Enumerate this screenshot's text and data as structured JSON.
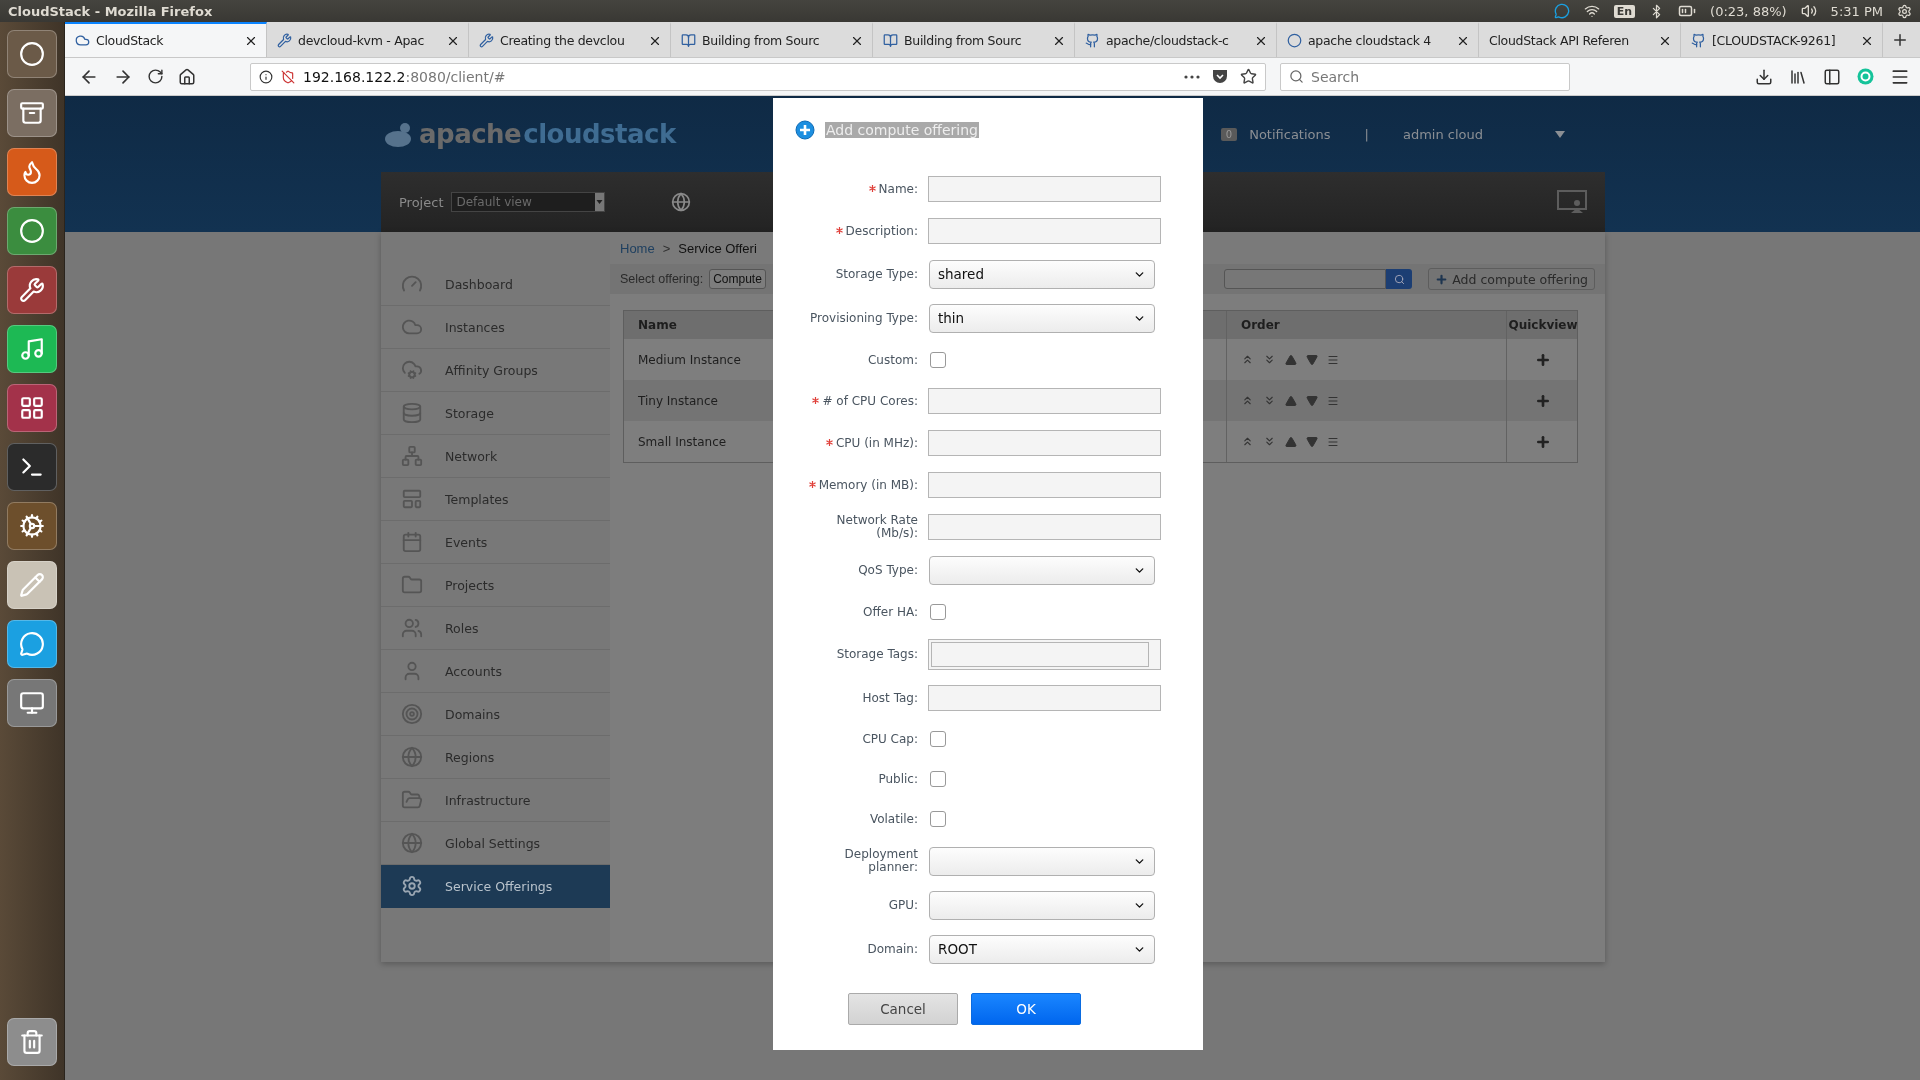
{
  "os_bar": {
    "title": "CloudStack - Mozilla Firefox",
    "keyboard": "En",
    "battery": "(0:23, 88%)",
    "clock": "5:31 PM"
  },
  "browser": {
    "tabs": [
      {
        "label": "CloudStack",
        "selected": true
      },
      {
        "label": "devcloud-kvm - Apac",
        "selected": false
      },
      {
        "label": "Creating the devclou",
        "selected": false
      },
      {
        "label": "Building from Sourc",
        "selected": false
      },
      {
        "label": "Building from Sourc",
        "selected": false
      },
      {
        "label": "apache/cloudstack-c",
        "selected": false
      },
      {
        "label": "apache cloudstack 4",
        "selected": false
      },
      {
        "label": "CloudStack API Referen",
        "selected": false
      },
      {
        "label": "[CLOUDSTACK-9261]",
        "selected": false
      }
    ],
    "url_host": "192.168.122.2",
    "url_path": ":8080/client/#",
    "search": {
      "placeholder": "Search"
    }
  },
  "app": {
    "logo": [
      "apache",
      "cloudstack"
    ],
    "notifications": {
      "count": "0",
      "label": "Notifications"
    },
    "separator": "|",
    "user": "admin cloud",
    "project": {
      "label": "Project",
      "value": "Default view"
    },
    "sidebar": [
      {
        "label": "Dashboard",
        "selected": false
      },
      {
        "label": "Instances",
        "selected": false
      },
      {
        "label": "Affinity Groups",
        "selected": false
      },
      {
        "label": "Storage",
        "selected": false
      },
      {
        "label": "Network",
        "selected": false
      },
      {
        "label": "Templates",
        "selected": false
      },
      {
        "label": "Events",
        "selected": false
      },
      {
        "label": "Projects",
        "selected": false
      },
      {
        "label": "Roles",
        "selected": false
      },
      {
        "label": "Accounts",
        "selected": false
      },
      {
        "label": "Domains",
        "selected": false
      },
      {
        "label": "Regions",
        "selected": false
      },
      {
        "label": "Infrastructure",
        "selected": false
      },
      {
        "label": "Global Settings",
        "selected": false
      },
      {
        "label": "Service Offerings",
        "selected": true
      }
    ],
    "breadcrumb": {
      "home": "Home",
      "separator": ">",
      "current": "Service Offeri"
    },
    "toolbar": {
      "label": "Select offering:",
      "value": "Compute",
      "add_button": "Add compute offering"
    },
    "table": {
      "columns": [
        "Name",
        "Order",
        "Quickview"
      ],
      "rows": [
        {
          "name": "Medium Instance"
        },
        {
          "name": "Tiny Instance"
        },
        {
          "name": "Small Instance"
        }
      ]
    }
  },
  "dialog": {
    "title": "Add compute offering",
    "fields": [
      {
        "kind": "text",
        "label": "Name:",
        "required": true
      },
      {
        "kind": "text",
        "label": "Description:",
        "required": true
      },
      {
        "kind": "select",
        "label": "Storage Type:",
        "value": "shared",
        "required": false
      },
      {
        "kind": "select",
        "label": "Provisioning Type:",
        "value": "thin",
        "required": false
      },
      {
        "kind": "checkbox",
        "label": "Custom:",
        "checked": false,
        "required": false
      },
      {
        "kind": "text",
        "label": "# of CPU Cores:",
        "required": true
      },
      {
        "kind": "text",
        "label": "CPU (in MHz):",
        "required": true
      },
      {
        "kind": "text",
        "label": "Memory (in MB):",
        "required": true
      },
      {
        "kind": "text",
        "label": "Network Rate (Mb/s):",
        "required": false
      },
      {
        "kind": "select",
        "label": "QoS Type:",
        "required": false
      },
      {
        "kind": "checkbox",
        "label": "Offer HA:",
        "checked": false,
        "required": false
      },
      {
        "kind": "tags",
        "label": "Storage Tags:",
        "required": false
      },
      {
        "kind": "text",
        "label": "Host Tag:",
        "required": false
      },
      {
        "kind": "checkbox",
        "label": "CPU Cap:",
        "checked": false,
        "required": false
      },
      {
        "kind": "checkbox",
        "label": "Public:",
        "checked": false,
        "required": false
      },
      {
        "kind": "checkbox",
        "label": "Volatile:",
        "checked": false,
        "required": false
      },
      {
        "kind": "select",
        "label": "Deployment planner:",
        "required": false
      },
      {
        "kind": "select",
        "label": "GPU:",
        "required": false
      },
      {
        "kind": "select",
        "label": "Domain:",
        "value": "ROOT",
        "required": false
      }
    ],
    "buttons": [
      {
        "kind": "cancel",
        "label": "Cancel"
      },
      {
        "kind": "ok",
        "label": "OK"
      }
    ]
  }
}
